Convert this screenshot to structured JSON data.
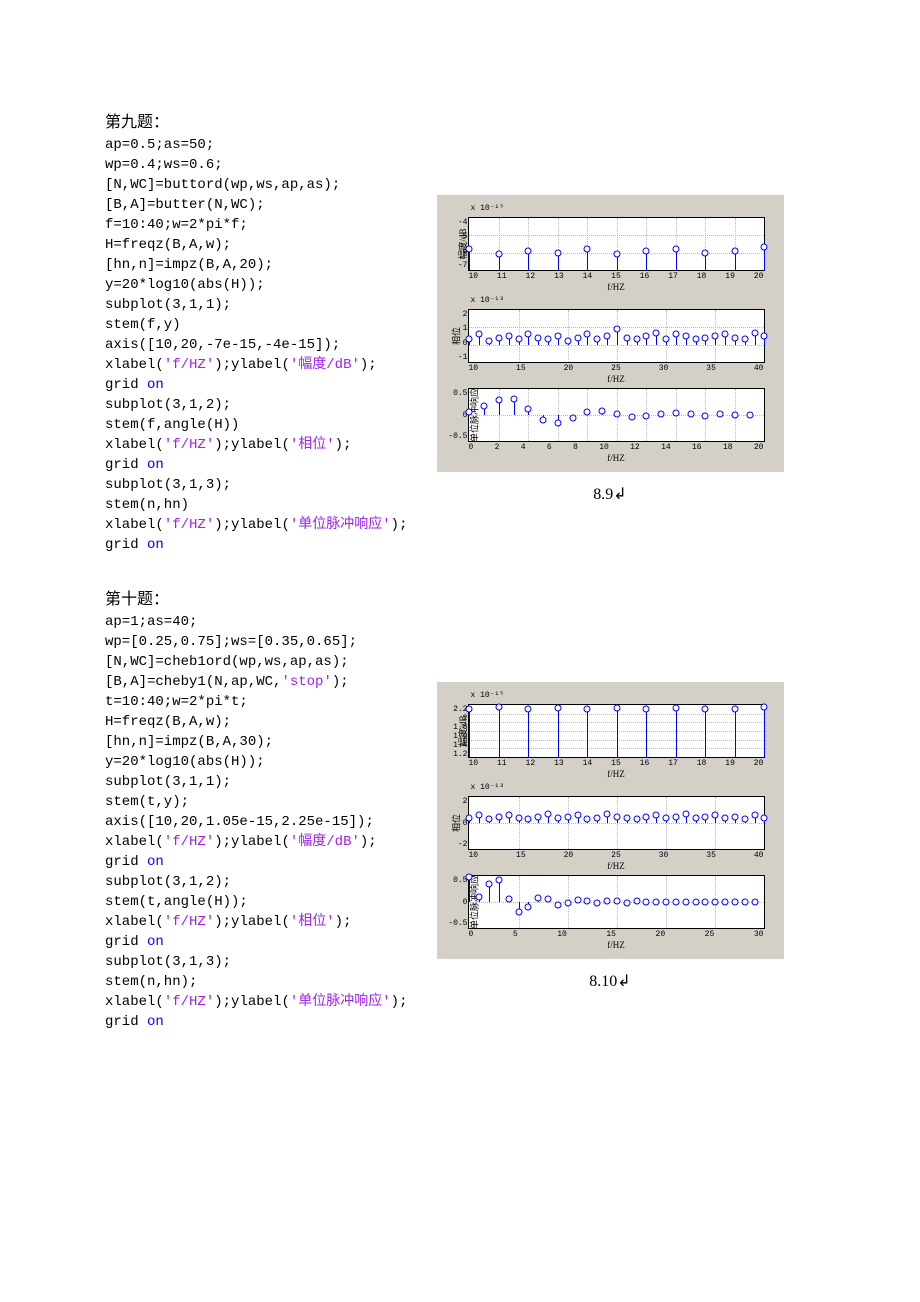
{
  "problem9": {
    "heading": "第九题：",
    "code": [
      {
        "t": "ap=0.5;as=50;"
      },
      {
        "t": "wp=0.4;ws=0.6;"
      },
      {
        "t": "[N,WC]=buttord(wp,ws,ap,as);"
      },
      {
        "t": "[B,A]=butter(N,WC);"
      },
      {
        "t": "f=10:40;w=2*pi*f;"
      },
      {
        "t": "H=freqz(B,A,w);"
      },
      {
        "t": "[hn,n]=impz(B,A,20);"
      },
      {
        "t": "y=20*log10(abs(H));"
      },
      {
        "t": "subplot(3,1,1);"
      },
      {
        "t": "stem(f,y)"
      },
      {
        "t": "axis([10,20,-7e-15,-4e-15]);"
      },
      {
        "pre": "xlabel(",
        "s1": "'f/HZ'",
        "mid": ");ylabel(",
        "s2": "'幅度/dB'",
        "post": ");"
      },
      {
        "pre": "grid ",
        "kw": "on"
      },
      {
        "t": "subplot(3,1,2);"
      },
      {
        "t": "stem(f,angle(H))"
      },
      {
        "pre": "xlabel(",
        "s1": "'f/HZ'",
        "mid": ");ylabel(",
        "s2": "'相位'",
        "post": ");"
      },
      {
        "pre": "grid ",
        "kw": "on"
      },
      {
        "t": "subplot(3,1,3);"
      },
      {
        "t": "stem(n,hn)"
      },
      {
        "pre": "xlabel(",
        "s1": "'f/HZ'",
        "mid": ");ylabel(",
        "s2": "'单位脉冲响应'",
        "post": ");"
      },
      {
        "pre": "grid ",
        "kw": "on"
      }
    ],
    "figure_caption": "8.9↲"
  },
  "problem10": {
    "heading": "第十题：",
    "code": [
      {
        "t": "ap=1;as=40;"
      },
      {
        "t": "wp=[0.25,0.75];ws=[0.35,0.65];"
      },
      {
        "t": "[N,WC]=cheb1ord(wp,ws,ap,as);"
      },
      {
        "pre": "[B,A]=cheby1(N,ap,WC,",
        "s1": "'stop'",
        "post": ");"
      },
      {
        "t": "t=10:40;w=2*pi*t;"
      },
      {
        "t": "H=freqz(B,A,w);"
      },
      {
        "t": "[hn,n]=impz(B,A,30);"
      },
      {
        "t": "y=20*log10(abs(H));"
      },
      {
        "t": "subplot(3,1,1);"
      },
      {
        "t": "stem(t,y);"
      },
      {
        "t": "axis([10,20,1.05e-15,2.25e-15]);"
      },
      {
        "pre": "xlabel(",
        "s1": "'f/HZ'",
        "mid": ");ylabel(",
        "s2": "'幅度/dB'",
        "post": ");"
      },
      {
        "pre": "grid ",
        "kw": "on"
      },
      {
        "t": "subplot(3,1,2);"
      },
      {
        "t": "stem(t,angle(H));"
      },
      {
        "pre": "xlabel(",
        "s1": "'f/HZ'",
        "mid": ");ylabel(",
        "s2": "'相位'",
        "post": ");"
      },
      {
        "pre": "grid ",
        "kw": "on"
      },
      {
        "t": "subplot(3,1,3);"
      },
      {
        "t": "stem(n,hn);"
      },
      {
        "pre": "xlabel(",
        "s1": "'f/HZ'",
        "mid": ");ylabel(",
        "s2": "'单位脉冲响应'",
        "post": ");"
      },
      {
        "pre": "grid ",
        "kw": "on"
      }
    ],
    "figure_caption": "8.10↲"
  },
  "chart_data": [
    {
      "id": "p9c1",
      "type": "stem",
      "title": "",
      "xlabel": "f/HZ",
      "ylabel": "幅度/dB",
      "exp": "x 10⁻¹⁵",
      "xlim": [
        10,
        20
      ],
      "ylim": [
        -7,
        -4
      ],
      "xticks": [
        10,
        11,
        12,
        13,
        14,
        15,
        16,
        17,
        18,
        19,
        20
      ],
      "yticks": [
        -7,
        -6,
        -5,
        -4
      ],
      "x": [
        10,
        11,
        12,
        13,
        14,
        15,
        16,
        17,
        18,
        19,
        20
      ],
      "y": [
        -5.8,
        -6.1,
        -5.9,
        -6.0,
        -5.8,
        -6.1,
        -5.9,
        -5.8,
        -6.0,
        -5.9,
        -5.7
      ],
      "baseline": -7
    },
    {
      "id": "p9c2",
      "type": "stem",
      "title": "",
      "xlabel": "f/HZ",
      "ylabel": "相位",
      "exp": "x 10⁻¹³",
      "xlim": [
        10,
        40
      ],
      "ylim": [
        -1,
        2
      ],
      "xticks": [
        10,
        15,
        20,
        25,
        30,
        35,
        40
      ],
      "yticks": [
        -1,
        0,
        1,
        2
      ],
      "x": [
        10,
        11,
        12,
        13,
        14,
        15,
        16,
        17,
        18,
        19,
        20,
        21,
        22,
        23,
        24,
        25,
        26,
        27,
        28,
        29,
        30,
        31,
        32,
        33,
        34,
        35,
        36,
        37,
        38,
        39,
        40
      ],
      "y": [
        0.3,
        0.6,
        0.2,
        0.4,
        0.5,
        0.3,
        0.6,
        0.4,
        0.3,
        0.5,
        0.2,
        0.4,
        0.6,
        0.3,
        0.5,
        0.9,
        0.4,
        0.3,
        0.5,
        0.7,
        0.3,
        0.6,
        0.5,
        0.3,
        0.4,
        0.5,
        0.6,
        0.4,
        0.3,
        0.7,
        0.5
      ],
      "baseline": 0
    },
    {
      "id": "p9c3",
      "type": "stem",
      "title": "",
      "xlabel": "f/HZ",
      "ylabel": "单位脉冲响应",
      "exp": "",
      "xlim": [
        0,
        20
      ],
      "ylim": [
        -0.5,
        0.5
      ],
      "xticks": [
        0,
        2,
        4,
        6,
        8,
        10,
        12,
        14,
        16,
        18,
        20
      ],
      "yticks": [
        -0.5,
        0,
        0.5
      ],
      "x": [
        0,
        1,
        2,
        3,
        4,
        5,
        6,
        7,
        8,
        9,
        10,
        11,
        12,
        13,
        14,
        15,
        16,
        17,
        18,
        19
      ],
      "y": [
        0.05,
        0.18,
        0.28,
        0.3,
        0.12,
        -0.1,
        -0.15,
        -0.05,
        0.05,
        0.08,
        0.02,
        -0.03,
        -0.02,
        0.02,
        0.03,
        0.01,
        -0.01,
        0.01,
        0.0,
        0.0
      ],
      "baseline": 0
    },
    {
      "id": "p10c1",
      "type": "stem",
      "title": "",
      "xlabel": "f/HZ",
      "ylabel": "幅度/dB",
      "exp": "x 10⁻¹⁵",
      "xlim": [
        10,
        20
      ],
      "ylim": [
        1.0,
        2.2
      ],
      "xticks": [
        10,
        11,
        12,
        13,
        14,
        15,
        16,
        17,
        18,
        19,
        20
      ],
      "yticks": [
        1.2,
        1.4,
        1.6,
        1.8,
        2,
        2.2
      ],
      "x": [
        10,
        11,
        12,
        13,
        14,
        15,
        16,
        17,
        18,
        19,
        20
      ],
      "y": [
        2.1,
        2.15,
        2.1,
        2.12,
        2.1,
        2.13,
        2.1,
        2.12,
        2.1,
        2.11,
        2.15
      ],
      "baseline": 1.0
    },
    {
      "id": "p10c2",
      "type": "stem",
      "title": "",
      "xlabel": "f/HZ",
      "ylabel": "相位",
      "exp": "x 10⁻¹³",
      "xlim": [
        10,
        40
      ],
      "ylim": [
        -2,
        2
      ],
      "xticks": [
        10,
        15,
        20,
        25,
        30,
        35,
        40
      ],
      "yticks": [
        -2,
        0,
        2
      ],
      "x": [
        10,
        11,
        12,
        13,
        14,
        15,
        16,
        17,
        18,
        19,
        20,
        21,
        22,
        23,
        24,
        25,
        26,
        27,
        28,
        29,
        30,
        31,
        32,
        33,
        34,
        35,
        36,
        37,
        38,
        39,
        40
      ],
      "y": [
        0.4,
        0.6,
        0.3,
        0.5,
        0.6,
        0.4,
        0.3,
        0.5,
        0.7,
        0.4,
        0.5,
        0.6,
        0.3,
        0.4,
        0.7,
        0.5,
        0.4,
        0.3,
        0.5,
        0.6,
        0.4,
        0.5,
        0.7,
        0.4,
        0.5,
        0.6,
        0.4,
        0.5,
        0.3,
        0.6,
        0.4
      ],
      "baseline": 0
    },
    {
      "id": "p10c3",
      "type": "stem",
      "title": "",
      "xlabel": "f/HZ",
      "ylabel": "单位脉冲响应",
      "exp": "",
      "xlim": [
        0,
        30
      ],
      "ylim": [
        -0.5,
        0.5
      ],
      "xticks": [
        0,
        5,
        10,
        15,
        20,
        25,
        30
      ],
      "yticks": [
        -0.5,
        0,
        0.5
      ],
      "x": [
        0,
        1,
        2,
        3,
        4,
        5,
        6,
        7,
        8,
        9,
        10,
        11,
        12,
        13,
        14,
        15,
        16,
        17,
        18,
        19,
        20,
        21,
        22,
        23,
        24,
        25,
        26,
        27,
        28,
        29
      ],
      "y": [
        0.48,
        0.1,
        0.35,
        0.42,
        0.05,
        -0.2,
        -0.1,
        0.08,
        0.05,
        -0.05,
        -0.02,
        0.03,
        0.02,
        -0.02,
        0.01,
        0.02,
        -0.01,
        0.01,
        0.0,
        0.0,
        0.0,
        0.0,
        0.0,
        0.0,
        0.0,
        0.0,
        0.0,
        0.0,
        0.0,
        0.0
      ],
      "baseline": 0
    }
  ]
}
